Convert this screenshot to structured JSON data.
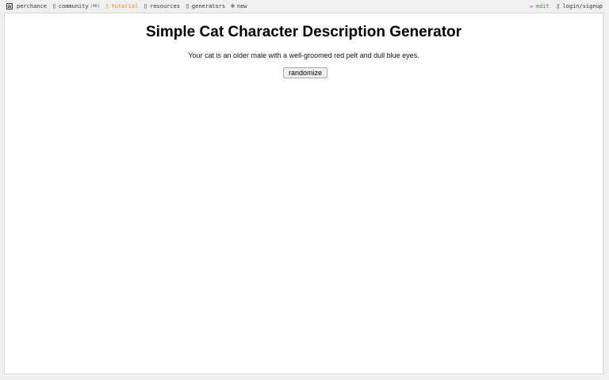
{
  "topbar": {
    "brand_label": "perchance",
    "community_label": "community",
    "community_count": "(46)",
    "tutorial_label": "tutorial",
    "resources_label": "resources",
    "generators_label": "generators",
    "new_label": "new",
    "edit_label": "edit",
    "login_label": "login/signup"
  },
  "main": {
    "title": "Simple Cat Character Description Generator",
    "output": "Your cat is an older male with a well-groomed red pelt and dull blue eyes.",
    "randomize_label": "randomize"
  },
  "colors": {
    "tutorial": "#e08a1e",
    "edit": "#3a8a2a"
  },
  "icons": {
    "brand": "die-icon",
    "community": "chat-icon",
    "tutorial": "book-icon",
    "resources": "folder-icon",
    "generators": "list-icon",
    "new": "plus-circle-icon",
    "edit": "pencil-icon",
    "login": "user-icon"
  }
}
